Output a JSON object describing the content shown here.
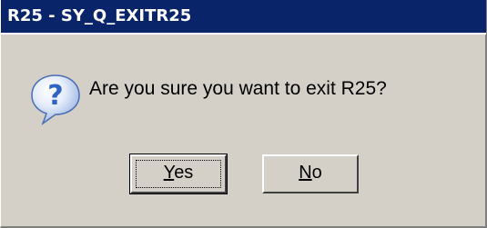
{
  "window": {
    "title": "R25 - SY_Q_EXITR25"
  },
  "dialog": {
    "icon": "question-icon",
    "message": "Are you sure you want to exit R25?"
  },
  "buttons": {
    "yes": {
      "mnemonic": "Y",
      "rest": "es"
    },
    "no": {
      "mnemonic": "N",
      "rest": "o"
    }
  },
  "colors": {
    "titlebar": "#0a246a",
    "dialog_bg": "#d4d0c8",
    "icon_blue": "#2f63c6"
  }
}
